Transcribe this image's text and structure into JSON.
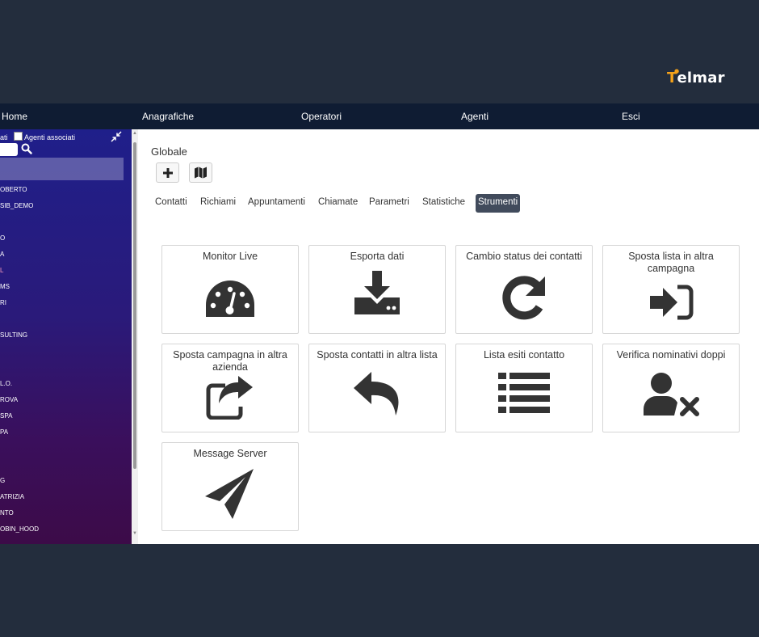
{
  "brand": {
    "name_first": "T",
    "name_rest": "elmar",
    "accent_color": "#f5a21a"
  },
  "navbar": {
    "items": [
      {
        "label": "Home"
      },
      {
        "label": "Anagrafiche"
      },
      {
        "label": "Operatori"
      },
      {
        "label": "Agenti"
      },
      {
        "label": "Esci"
      }
    ]
  },
  "sidebar": {
    "filter_label_1": "ati",
    "filter_label_2": "Agenti associati",
    "items": [
      "OBERTO",
      "SIB_DEMO",
      "O",
      "A",
      "L",
      "MS",
      "RI",
      "SULTING",
      "",
      "L.O.",
      "ROVA",
      "SPA",
      "PA",
      "G",
      "ATRIZIA",
      "NTO",
      "OBIN_HOOD"
    ]
  },
  "main": {
    "title": "Globale",
    "tabs": [
      {
        "label": "Contatti"
      },
      {
        "label": "Richiami"
      },
      {
        "label": "Appuntamenti"
      },
      {
        "label": "Chiamate"
      },
      {
        "label": "Parametri"
      },
      {
        "label": "Statistiche"
      },
      {
        "label": "Strumenti"
      }
    ],
    "tools": [
      {
        "label": "Monitor Live",
        "icon": "gauge-icon"
      },
      {
        "label": "Esporta dati",
        "icon": "download-icon"
      },
      {
        "label": "Cambio status dei contatti",
        "icon": "redo-icon"
      },
      {
        "label": "Sposta lista in altra campagna",
        "icon": "sign-in-icon"
      },
      {
        "label": "Sposta campagna in altra azienda",
        "icon": "share-square-icon"
      },
      {
        "label": "Sposta contatti in altra lista",
        "icon": "reply-icon"
      },
      {
        "label": "Lista esiti contatto",
        "icon": "list-icon"
      },
      {
        "label": "Verifica nominativi doppi",
        "icon": "user-times-icon"
      },
      {
        "label": "Message Server",
        "icon": "paper-plane-icon"
      }
    ]
  }
}
